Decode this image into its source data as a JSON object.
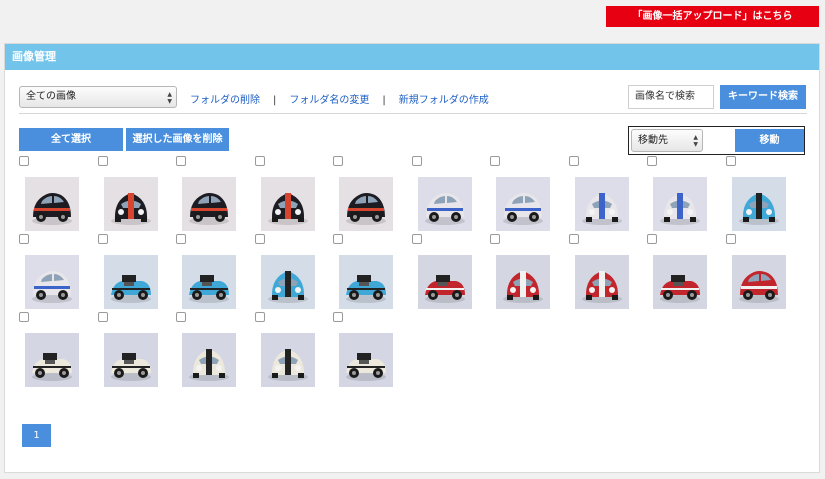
{
  "header": {
    "bulk_upload_label": "「画像一括アップロード」はこちら"
  },
  "panel": {
    "title": "画像管理"
  },
  "toolbar": {
    "folder_select_value": "全ての画像",
    "delete_folder_label": "フォルダの削除",
    "separator": "|",
    "rename_folder_label": "フォルダ名の変更",
    "new_folder_label": "新規フォルダの作成",
    "search_placeholder": "画像名で検索",
    "keyword_search_label": "キーワード検索"
  },
  "actions": {
    "select_all_label": "全て選択",
    "delete_selected_label": "選択した画像を削除",
    "move_target_value": "移動先",
    "move_label": "移動"
  },
  "images": [
    {
      "color": "#1c1c22",
      "stripe": "#d8452f",
      "bg": "#e4e0e4",
      "view": "side"
    },
    {
      "color": "#1c1c22",
      "stripe": "#d8452f",
      "bg": "#e4e0e4",
      "view": "rear"
    },
    {
      "color": "#1c1c22",
      "stripe": "#d8452f",
      "bg": "#e4e0e4",
      "view": "side"
    },
    {
      "color": "#1c1c22",
      "stripe": "#d8452f",
      "bg": "#e4e0e4",
      "view": "front"
    },
    {
      "color": "#1c1c22",
      "stripe": "#d8452f",
      "bg": "#e4e0e4",
      "view": "angle"
    },
    {
      "color": "#e8e6ea",
      "stripe": "#3b63c9",
      "bg": "#dcdde8",
      "view": "side"
    },
    {
      "color": "#e8e6ea",
      "stripe": "#3b63c9",
      "bg": "#dcdde8",
      "view": "side"
    },
    {
      "color": "#e8e6ea",
      "stripe": "#3b63c9",
      "bg": "#dcdde8",
      "view": "front"
    },
    {
      "color": "#e8e6ea",
      "stripe": "#3b63c9",
      "bg": "#dcdde8",
      "view": "rear"
    },
    {
      "color": "#3fa8d6",
      "stripe": "#222222",
      "bg": "#d4dce8",
      "view": "front"
    },
    {
      "color": "#e8e6ea",
      "stripe": "#3b63c9",
      "bg": "#dcdde8",
      "view": "side"
    },
    {
      "color": "#3fa8d6",
      "stripe": "#222222",
      "bg": "#d4dce8",
      "view": "open"
    },
    {
      "color": "#3fa8d6",
      "stripe": "#222222",
      "bg": "#d4dce8",
      "view": "open"
    },
    {
      "color": "#3fa8d6",
      "stripe": "#222222",
      "bg": "#d4dce8",
      "view": "front"
    },
    {
      "color": "#3fa8d6",
      "stripe": "#222222",
      "bg": "#d4dce8",
      "view": "open"
    },
    {
      "color": "#c2262c",
      "stripe": "#f1f1f1",
      "bg": "#d4d6e2",
      "view": "open"
    },
    {
      "color": "#c2262c",
      "stripe": "#f1f1f1",
      "bg": "#d4d6e2",
      "view": "front"
    },
    {
      "color": "#c2262c",
      "stripe": "#f1f1f1",
      "bg": "#d4d6e2",
      "view": "front"
    },
    {
      "color": "#c2262c",
      "stripe": "#f1f1f1",
      "bg": "#d4d6e2",
      "view": "open"
    },
    {
      "color": "#c2262c",
      "stripe": "#f1f1f1",
      "bg": "#d4d6e2",
      "view": "angle"
    },
    {
      "color": "#ece8dc",
      "stripe": "#222222",
      "bg": "#d4d6e4",
      "view": "open"
    },
    {
      "color": "#ece8dc",
      "stripe": "#222222",
      "bg": "#d4d6e4",
      "view": "open"
    },
    {
      "color": "#ece8dc",
      "stripe": "#222222",
      "bg": "#d4d6e4",
      "view": "front"
    },
    {
      "color": "#ece8dc",
      "stripe": "#222222",
      "bg": "#d4d6e4",
      "view": "front"
    },
    {
      "color": "#ece8dc",
      "stripe": "#222222",
      "bg": "#d4d6e4",
      "view": "open"
    }
  ],
  "pagination": {
    "current_page": "1"
  }
}
